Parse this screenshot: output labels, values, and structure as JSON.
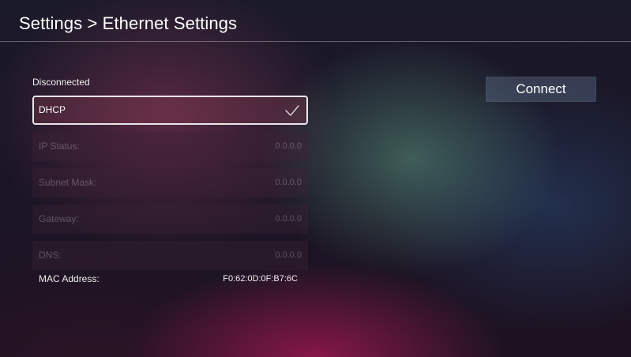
{
  "header": {
    "title": "Settings > Ethernet Settings"
  },
  "status": {
    "label": "Disconnected"
  },
  "mode": {
    "label": "DHCP",
    "selected_icon": "checkmark-icon"
  },
  "fields": [
    {
      "label": "IP Status:",
      "value": "0.0.0.0"
    },
    {
      "label": "Subnet Mask:",
      "value": "0.0.0.0"
    },
    {
      "label": "Gateway:",
      "value": "0.0.0.0"
    },
    {
      "label": "DNS:",
      "value": "0.0.0.0"
    }
  ],
  "mac": {
    "label": "MAC Address:",
    "value": "F0:62:0D:0F:B7:6C"
  },
  "actions": {
    "connect_label": "Connect"
  },
  "colors": {
    "selection_border": "#e9e6ea",
    "disabled_text": "rgba(255,255,255,0.25)",
    "button_bg": "#5f738c"
  }
}
